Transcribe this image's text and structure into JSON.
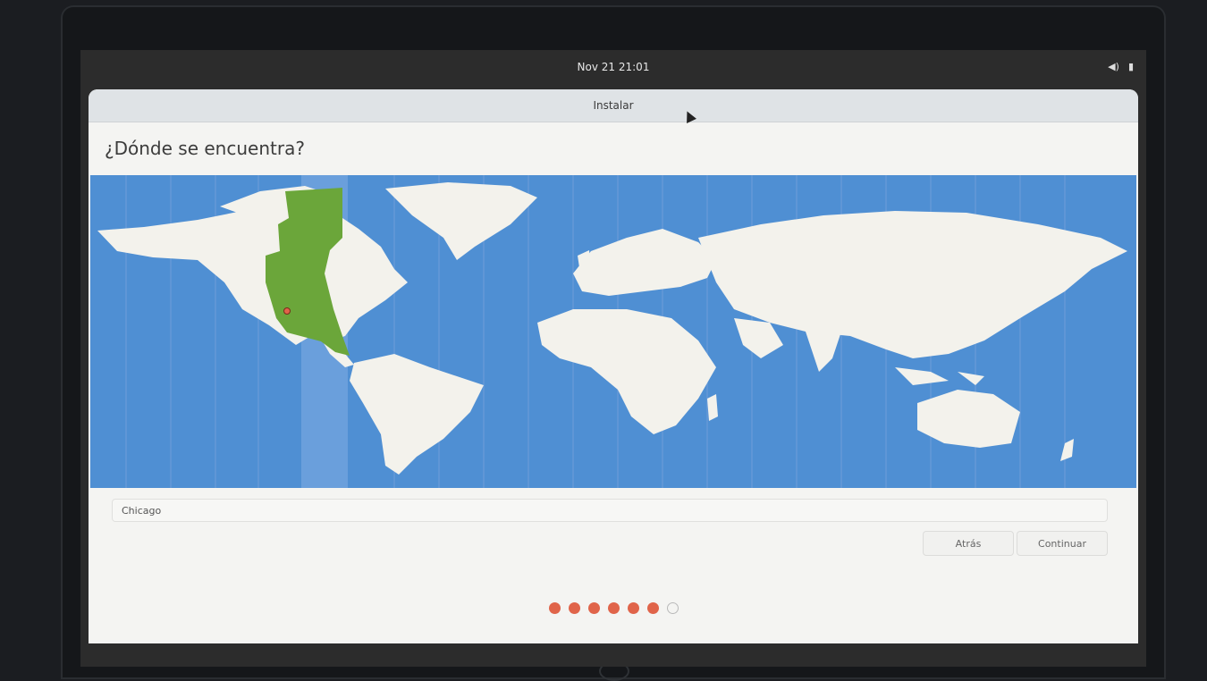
{
  "topbar": {
    "clock": "Nov 21  21:01",
    "volume_icon": "volume-icon",
    "battery_icon": "battery-icon"
  },
  "window": {
    "title": "Instalar",
    "heading": "¿Dónde se encuentra?"
  },
  "location": {
    "value": "Chicago"
  },
  "buttons": {
    "back": "Atrás",
    "continue": "Continuar"
  },
  "progress": {
    "total_steps": 7,
    "completed_steps": 6
  },
  "colors": {
    "ocean": "#4f8fd3",
    "land": "#f3f2ec",
    "selected_timezone": "#6ba63a",
    "progress_dot": "#e0644a"
  }
}
